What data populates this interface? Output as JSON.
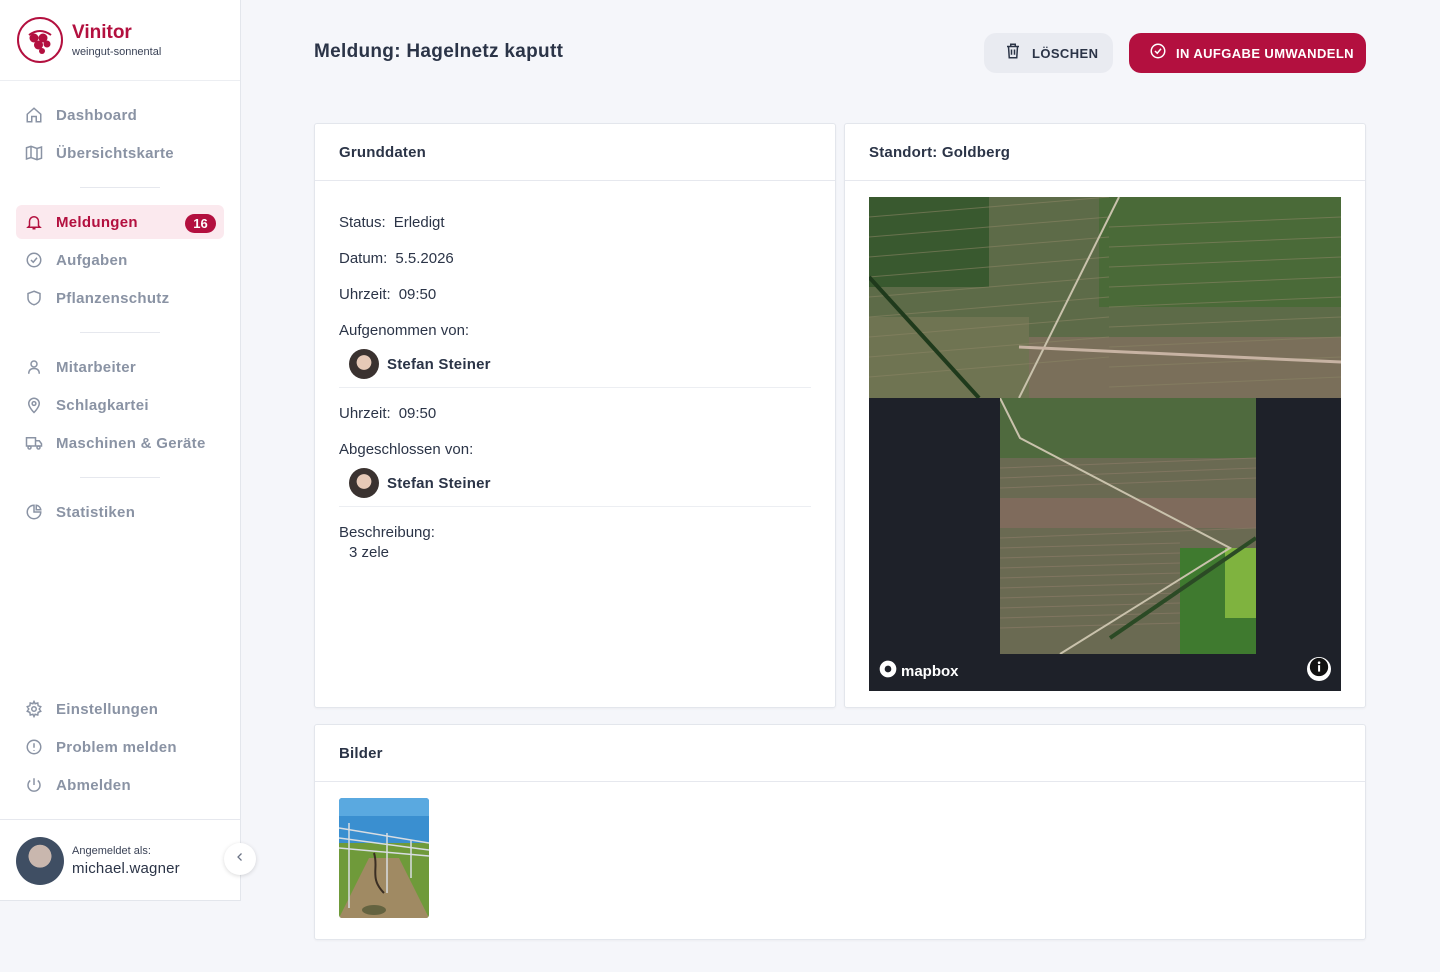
{
  "brand": {
    "name": "Vinitor",
    "tenant": "weingut-sonnental",
    "color": "#b3103f"
  },
  "sidebar": {
    "items": [
      {
        "label": "Dashboard",
        "icon": "home-icon"
      },
      {
        "label": "Übersichtskarte",
        "icon": "map-icon"
      },
      {
        "label": "Meldungen",
        "icon": "bell-icon",
        "badge": "16",
        "active": true
      },
      {
        "label": "Aufgaben",
        "icon": "check-circle-icon"
      },
      {
        "label": "Pflanzenschutz",
        "icon": "shield-icon"
      },
      {
        "label": "Mitarbeiter",
        "icon": "user-icon"
      },
      {
        "label": "Schlagkartei",
        "icon": "map-pin-icon"
      },
      {
        "label": "Maschinen & Geräte",
        "icon": "truck-icon"
      },
      {
        "label": "Statistiken",
        "icon": "pie-chart-icon"
      },
      {
        "label": "Einstellungen",
        "icon": "gear-icon"
      },
      {
        "label": "Problem melden",
        "icon": "alert-circle-icon"
      },
      {
        "label": "Abmelden",
        "icon": "power-icon"
      }
    ]
  },
  "user": {
    "caption": "Angemeldet als:",
    "username": "michael.wagner"
  },
  "header": {
    "title": "Meldung: Hagelnetz kaputt",
    "delete_label": "LÖSCHEN",
    "convert_label": "IN AUFGABE UMWANDELN"
  },
  "grunddaten": {
    "title": "Grunddaten",
    "status_label": "Status:",
    "status": "Erledigt",
    "date_label": "Datum:",
    "date": "5.5.2026",
    "time_label": "Uhrzeit:",
    "time": "09:50",
    "recorded_by_label": "Aufgenommen von:",
    "recorded_by": "Stefan Steiner",
    "closed_time_label": "Uhrzeit:",
    "closed_time": "09:50",
    "closed_by_label": "Abgeschlossen von:",
    "closed_by": "Stefan Steiner",
    "description_label": "Beschreibung:",
    "description": "3 zele"
  },
  "location": {
    "title": "Standort: Goldberg",
    "attribution": "mapbox"
  },
  "images": {
    "title": "Bilder"
  }
}
